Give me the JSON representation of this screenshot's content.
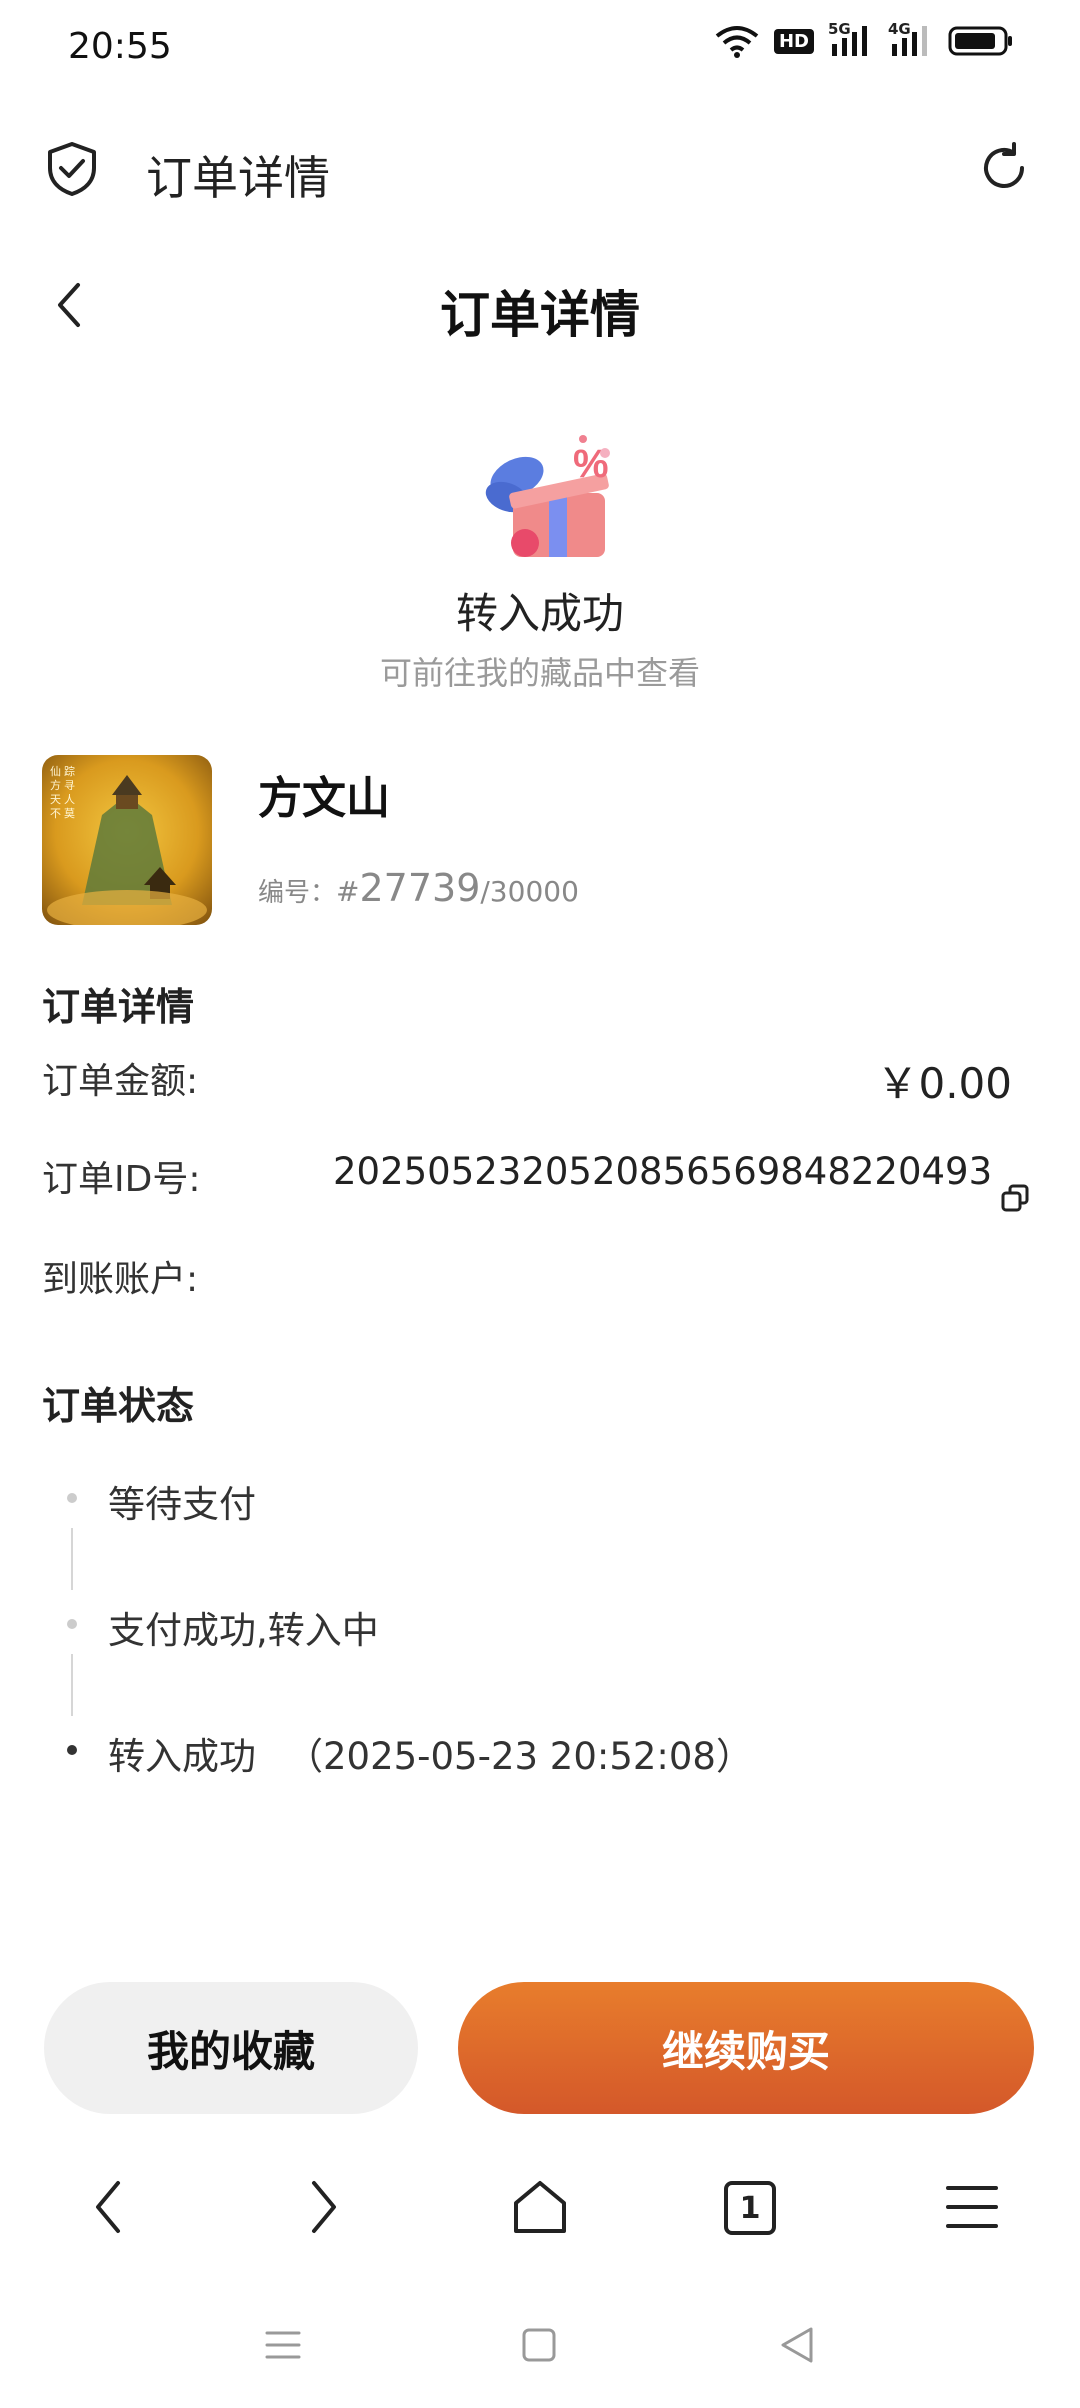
{
  "status_bar": {
    "time": "20:55",
    "hd_label": "HD",
    "net_5g": "5G",
    "net_4g": "4G"
  },
  "browser": {
    "title": "订单详情",
    "icons": [
      "shield-check-icon",
      "refresh-icon"
    ]
  },
  "header": {
    "title": "订单详情"
  },
  "success": {
    "title": "转入成功",
    "subtitle": "可前往我的藏品中查看"
  },
  "product": {
    "name": "方文山",
    "serial_label": "编号：",
    "serial_hash": "#",
    "serial_number": "27739",
    "serial_total": "/30000"
  },
  "order_details": {
    "section_title": "订单详情",
    "amount_label": "订单金额:",
    "amount_value": "￥0.00",
    "id_label": "订单ID号:",
    "id_value": "2025052320520856569848220493",
    "account_label": "到账账户:"
  },
  "order_status": {
    "section_title": "订单状态",
    "steps": [
      {
        "label": "等待支付",
        "time": ""
      },
      {
        "label": "支付成功,转入中",
        "time": ""
      },
      {
        "label": "转入成功",
        "time": "（2025-05-23 20:52:08）"
      }
    ]
  },
  "actions": {
    "favorites_label": "我的收藏",
    "buy_label": "继续购买",
    "buy_color": "#de6a2b"
  },
  "bottom_nav": {
    "tab_count": "1"
  }
}
